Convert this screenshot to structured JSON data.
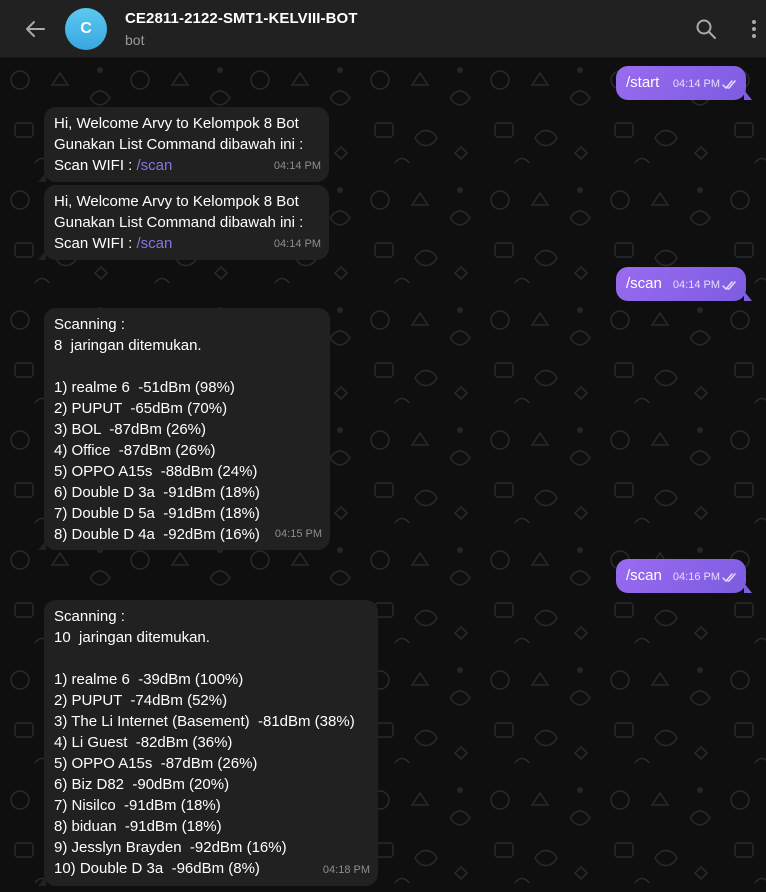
{
  "header": {
    "avatar_letter": "C",
    "title": "CE2811-2122-SMT1-KELVIII-BOT",
    "subtitle": "bot"
  },
  "colors": {
    "accent": "#8774e1",
    "outgoing_bubble": "#8a63e6",
    "incoming_bubble": "#212121",
    "header_bg": "#212121"
  },
  "messages": {
    "m1": {
      "text": "/start",
      "time": "04:14 PM"
    },
    "m2": {
      "line1": "Hi, Welcome Arvy to Kelompok 8 Bot",
      "line2": "Gunakan List Command dibawah ini :",
      "line3_prefix": "Scan WIFI : ",
      "command": "/scan",
      "time": "04:14 PM"
    },
    "m3": {
      "line1": "Hi, Welcome Arvy to Kelompok 8 Bot",
      "line2": "Gunakan List Command dibawah ini :",
      "line3_prefix": "Scan WIFI : ",
      "command": "/scan",
      "time": "04:14 PM"
    },
    "m4": {
      "text": "/scan",
      "time": "04:14 PM"
    },
    "m5": {
      "text": "Scanning :\n8  jaringan ditemukan.\n\n1) realme 6  -51dBm (98%)\n2) PUPUT  -65dBm (70%)\n3) BOL  -87dBm (26%)\n4) Office  -87dBm (26%)\n5) OPPO A15s  -88dBm (24%)\n6) Double D 3a  -91dBm (18%)\n7) Double D 5a  -91dBm (18%)\n8) Double D 4a  -92dBm (16%)",
      "time": "04:15 PM"
    },
    "m6": {
      "text": "/scan",
      "time": "04:16 PM"
    },
    "m7": {
      "text": "Scanning :\n10  jaringan ditemukan.\n\n1) realme 6  -39dBm (100%)\n2) PUPUT  -74dBm (52%)\n3) The Li Internet (Basement)  -81dBm (38%)\n4) Li Guest  -82dBm (36%)\n5) OPPO A15s  -87dBm (26%)\n6) Biz D82  -90dBm (20%)\n7) Nisilco  -91dBm (18%)\n8) biduan  -91dBm (18%)\n9) Jesslyn Brayden  -92dBm (16%)\n10) Double D 3a  -96dBm (8%)",
      "time": "04:18 PM"
    }
  }
}
